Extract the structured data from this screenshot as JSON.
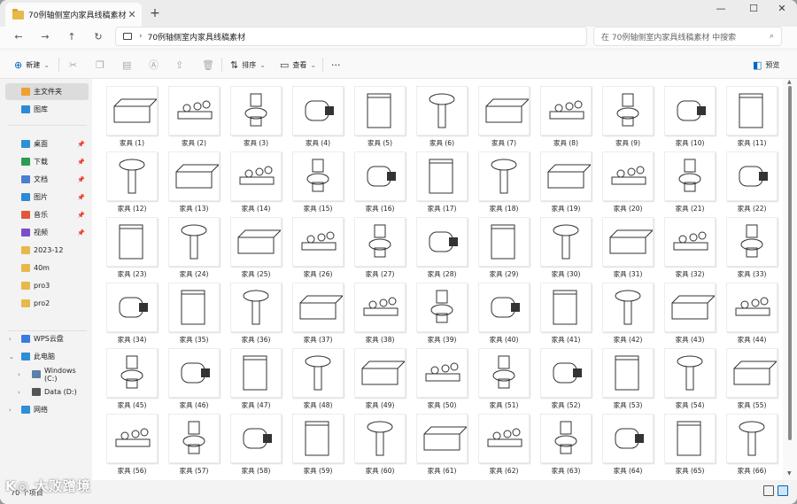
{
  "window": {
    "tab_title": "70例轴侧室内家具线稿素材",
    "new_tab": "+",
    "minimize": "—",
    "maximize": "☐",
    "close": "✕"
  },
  "address": {
    "chevron": "›",
    "path": "70例轴侧室内家具线稿素材",
    "search_placeholder": "在 70例轴侧室内家具线稿素材 中搜索"
  },
  "toolbar": {
    "new_label": "新建",
    "sort_label": "排序",
    "view_label": "查看",
    "more": "···",
    "preview_label": "预览"
  },
  "sidebar": {
    "home": "主文件夹",
    "gallery": "图库",
    "quick": [
      {
        "label": "桌面",
        "color": "#2d8fd6"
      },
      {
        "label": "下载",
        "color": "#2e9b52"
      },
      {
        "label": "文档",
        "color": "#4a7fd0"
      },
      {
        "label": "图片",
        "color": "#2a8bd8"
      },
      {
        "label": "音乐",
        "color": "#e2563a"
      },
      {
        "label": "视频",
        "color": "#7b4fc9"
      },
      {
        "label": "2023-12",
        "color": "#e8b84a"
      },
      {
        "label": "40m",
        "color": "#e8b84a"
      },
      {
        "label": "pro3",
        "color": "#e8b84a"
      },
      {
        "label": "pro2",
        "color": "#e8b84a"
      }
    ],
    "wps": "WPS云盘",
    "this_pc": "此电脑",
    "drive_c": "Windows (C:)",
    "drive_d": "Data (D:)",
    "network": "网络"
  },
  "items": [
    "家具 (1)",
    "家具 (2)",
    "家具 (3)",
    "家具 (4)",
    "家具 (5)",
    "家具 (6)",
    "家具 (7)",
    "家具 (8)",
    "家具 (9)",
    "家具 (10)",
    "家具 (11)",
    "家具 (12)",
    "家具 (13)",
    "家具 (14)",
    "家具 (15)",
    "家具 (16)",
    "家具 (17)",
    "家具 (18)",
    "家具 (19)",
    "家具 (20)",
    "家具 (21)",
    "家具 (22)",
    "家具 (23)",
    "家具 (24)",
    "家具 (25)",
    "家具 (26)",
    "家具 (27)",
    "家具 (28)",
    "家具 (29)",
    "家具 (30)",
    "家具 (31)",
    "家具 (32)",
    "家具 (33)",
    "家具 (34)",
    "家具 (35)",
    "家具 (36)",
    "家具 (37)",
    "家具 (38)",
    "家具 (39)",
    "家具 (40)",
    "家具 (41)",
    "家具 (42)",
    "家具 (43)",
    "家具 (44)",
    "家具 (45)",
    "家具 (46)",
    "家具 (47)",
    "家具 (48)",
    "家具 (49)",
    "家具 (50)",
    "家具 (51)",
    "家具 (52)",
    "家具 (53)",
    "家具 (54)",
    "家具 (55)",
    "家具 (56)",
    "家具 (57)",
    "家具 (58)",
    "家具 (59)",
    "家具 (60)",
    "家具 (61)",
    "家具 (62)",
    "家具 (63)",
    "家具 (64)",
    "家具 (65)",
    "家具 (66)"
  ],
  "status": {
    "count": "70 个项目"
  },
  "watermark": "K◎ 大败蹭境"
}
